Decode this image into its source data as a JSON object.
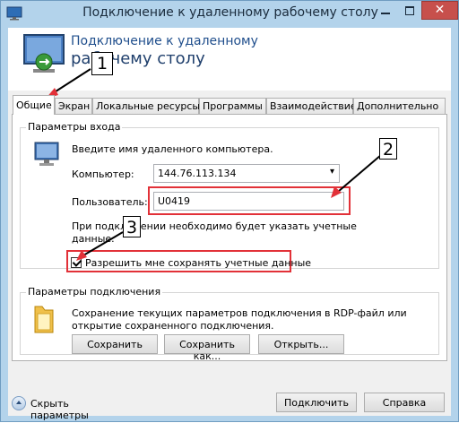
{
  "window": {
    "title": "Подключение к удаленному рабочему столу"
  },
  "header": {
    "line1": "Подключение к удаленному",
    "line2": "рабочему столу"
  },
  "tabs": [
    {
      "label": "Общие",
      "active": true
    },
    {
      "label": "Экран"
    },
    {
      "label": "Локальные ресурсы"
    },
    {
      "label": "Программы"
    },
    {
      "label": "Взаимодействие"
    },
    {
      "label": "Дополнительно"
    }
  ],
  "logon": {
    "group_title": "Параметры входа",
    "instruction": "Введите имя удаленного компьютера.",
    "computer_label": "Компьютер:",
    "computer_value": "144.76.113.134",
    "user_label": "Пользователь:",
    "user_value": "U0419",
    "note_line1": "При подключении необходимо будет указать учетные",
    "note_line2": "данные.",
    "save_credentials_label": "Разрешить мне сохранять учетные данные",
    "save_credentials_checked": true
  },
  "connection": {
    "group_title": "Параметры подключения",
    "desc_line1": "Сохранение текущих параметров подключения в RDP-файл или",
    "desc_line2": "открытие сохраненного подключения.",
    "save_label": "Сохранить",
    "save_as_label": "Сохранить как...",
    "open_label": "Открыть..."
  },
  "footer": {
    "hide_options_label": "Скрыть параметры",
    "connect_label": "Подключить",
    "help_label": "Справка"
  },
  "annotations": {
    "callout_1": "1",
    "callout_2": "2",
    "callout_3": "3"
  },
  "colors": {
    "frame": "#b3d3eb",
    "close_button": "#c7504c",
    "highlight_red": "#e23138"
  }
}
